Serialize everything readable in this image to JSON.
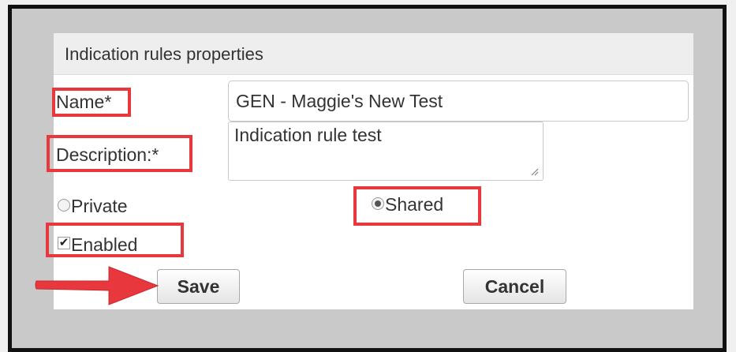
{
  "panel": {
    "title": "Indication rules properties"
  },
  "form": {
    "name_label": "Name*",
    "name_value": "GEN - Maggie's New Test",
    "description_label": "Description:*",
    "description_value": "Indication rule test",
    "private_label": "Private",
    "private_checked": false,
    "shared_label": "Shared",
    "shared_checked": true,
    "enabled_label": "Enabled",
    "enabled_checked": true
  },
  "buttons": {
    "save": "Save",
    "cancel": "Cancel"
  },
  "icons": {
    "enabled_checkbox": "checkmark-icon",
    "private_radio": "radio-unchecked-icon",
    "shared_radio": "radio-checked-icon",
    "annotation": "arrow-right-icon",
    "textarea_resize": "resize-grip-icon"
  },
  "colors": {
    "highlight": "#e8383d",
    "panel_header_bg": "#eeeeee",
    "frame_border": "#111111"
  }
}
